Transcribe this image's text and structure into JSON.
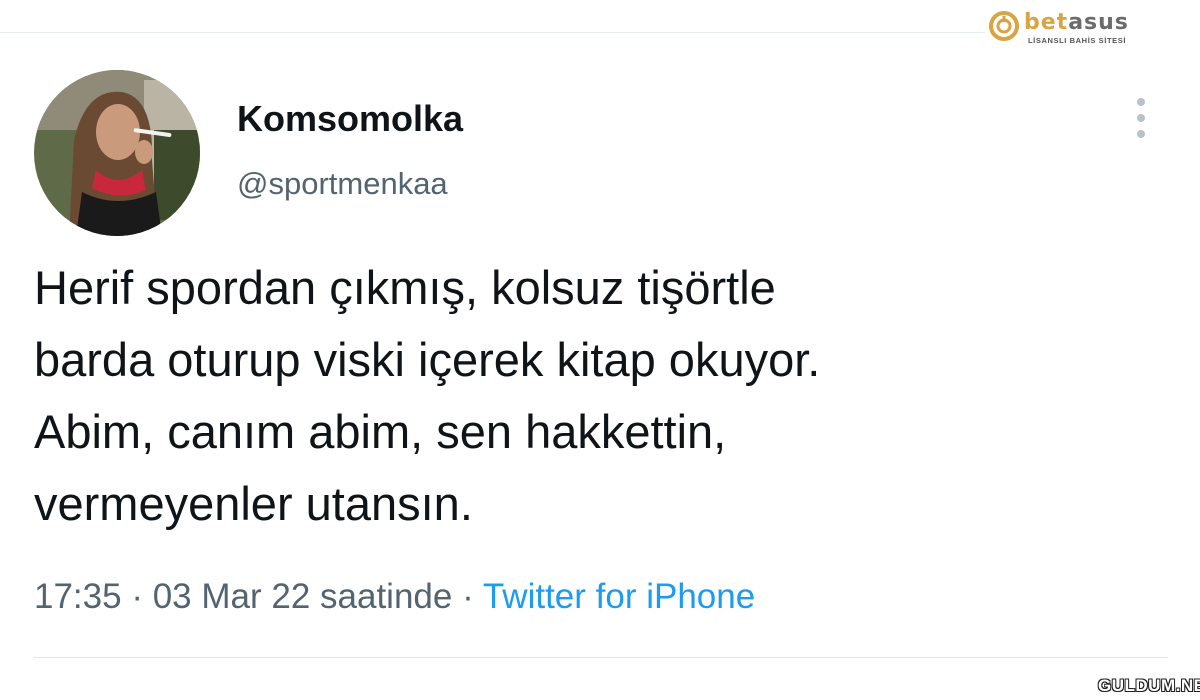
{
  "brand": {
    "name_accent": "bet",
    "name_rest": "asus",
    "tagline": "LİSANSLI BAHİS SİTESİ",
    "accent_color": "#d9a441"
  },
  "tweet": {
    "display_name": "Komsomolka",
    "handle": "@sportmenkaa",
    "text_lines": [
      "Herif spordan çıkmış, kolsuz tişörtle",
      "barda oturup viski içerek kitap okuyor.",
      "Abim, canım abim, sen hakkettin,",
      "vermeyenler utansın."
    ],
    "time": "17:35",
    "date": "03 Mar 22 saatinde",
    "separator": "·",
    "source": "Twitter for iPhone",
    "more_icon": "more-vertical-icon",
    "link_color": "#1d9bf0"
  },
  "watermark": {
    "text": "GULDUM.NET"
  }
}
